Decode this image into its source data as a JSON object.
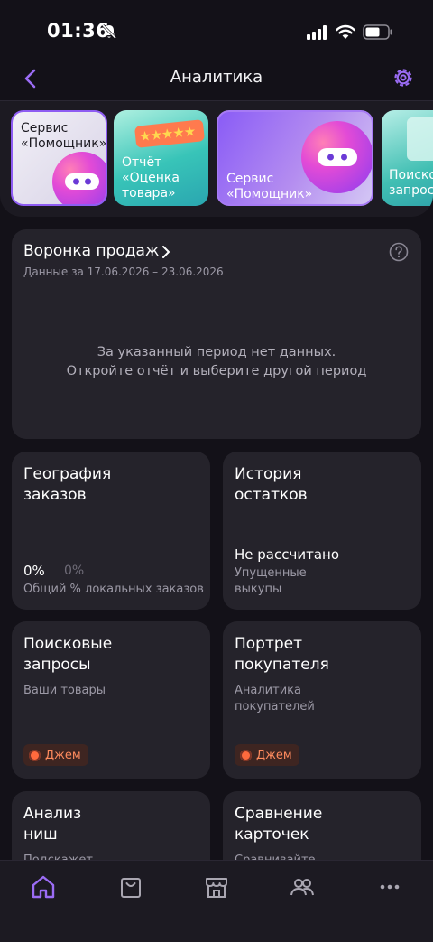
{
  "status_bar": {
    "time": "01:36"
  },
  "header": {
    "title": "Аналитика"
  },
  "banners": [
    {
      "label": "Сервис «Помощник»"
    },
    {
      "label": "Отчёт «Оценка товара»"
    },
    {
      "label": "Сервис «Помощник»"
    },
    {
      "label": "Поиско запрос"
    }
  ],
  "funnel": {
    "title": "Воронка продаж",
    "period": "Данные за 17.06.2026 – 23.06.2026",
    "empty_line1": "За указанный период нет данных.",
    "empty_line2": "Откройте отчёт и выберите другой период"
  },
  "cards": {
    "geo": {
      "title": "География заказов",
      "value": "0%",
      "value_secondary": "0%",
      "caption": "Общий % локальных заказов"
    },
    "stock": {
      "title": "История остатков",
      "status": "Не рассчитано",
      "caption": "Упущенные выкупы"
    },
    "search": {
      "title": "Поисковые запросы",
      "subtitle": "Ваши товары",
      "badge": "Джем"
    },
    "portrait": {
      "title": "Портрет покупателя",
      "subtitle": "Аналитика покупателей",
      "badge": "Джем"
    },
    "niche": {
      "title": "Анализ ниш",
      "subtitle": "Подскажет"
    },
    "compare": {
      "title": "Сравнение карточек",
      "subtitle": "Сравнивайте"
    }
  },
  "colors": {
    "accent": "#8e5cf2",
    "background": "#131118",
    "card": "#25232b",
    "jam": "#ff8b5e"
  },
  "icons": [
    "home-icon",
    "bag-icon",
    "store-icon",
    "users-icon",
    "more-icon"
  ]
}
